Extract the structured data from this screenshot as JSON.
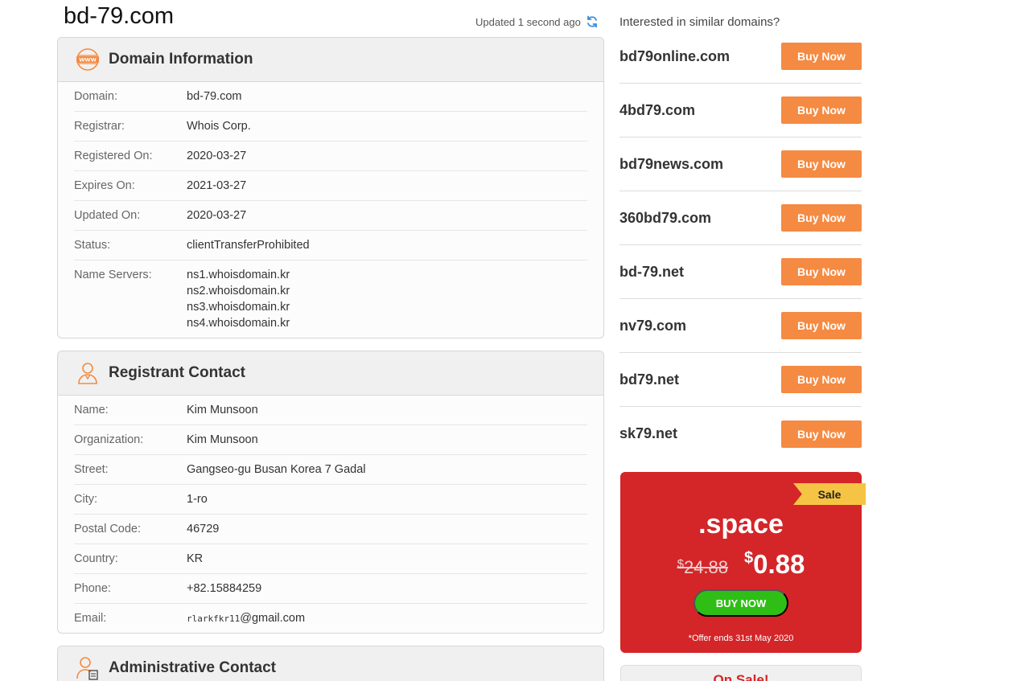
{
  "page": {
    "title": "bd-79.com",
    "updated": "Updated 1 second ago"
  },
  "colors": {
    "accent": "#f58a42",
    "promo_bg": "#d42528",
    "promo_btn": "#2fbe16",
    "ribbon": "#f6c444"
  },
  "domain_info": {
    "header": "Domain Information",
    "icon": "www-icon",
    "rows": [
      {
        "k": "Domain:",
        "v": "bd-79.com"
      },
      {
        "k": "Registrar:",
        "v": "Whois Corp."
      },
      {
        "k": "Registered On:",
        "v": "2020-03-27"
      },
      {
        "k": "Expires On:",
        "v": "2021-03-27"
      },
      {
        "k": "Updated On:",
        "v": "2020-03-27"
      },
      {
        "k": "Status:",
        "v": "clientTransferProhibited"
      }
    ],
    "ns_label": "Name Servers:",
    "ns": [
      "ns1.whoisdomain.kr",
      "ns2.whoisdomain.kr",
      "ns3.whoisdomain.kr",
      "ns4.whoisdomain.kr"
    ]
  },
  "registrant": {
    "header": "Registrant Contact",
    "icon": "person-icon",
    "rows": [
      {
        "k": "Name:",
        "v": "Kim Munsoon"
      },
      {
        "k": "Organization:",
        "v": "Kim Munsoon"
      },
      {
        "k": "Street:",
        "v": "Gangseo-gu Busan Korea 7 Gadal"
      },
      {
        "k": "City:",
        "v": "1-ro"
      },
      {
        "k": "Postal Code:",
        "v": "46729"
      },
      {
        "k": "Country:",
        "v": "KR"
      },
      {
        "k": "Phone:",
        "v": "+82.15884259"
      }
    ],
    "email_label": "Email:",
    "email_user": "rlarkfkr11",
    "email_domain": "@gmail.com"
  },
  "admin": {
    "header": "Administrative Contact",
    "icon": "admin-person-icon"
  },
  "sidebar": {
    "question": "Interested in similar domains?",
    "buy_label": "Buy Now",
    "domains": [
      "bd79online.com",
      "4bd79.com",
      "bd79news.com",
      "360bd79.com",
      "bd-79.net",
      "nv79.com",
      "bd79.net",
      "sk79.net"
    ]
  },
  "promo": {
    "ribbon": "Sale",
    "tld": ".space",
    "currency": "$",
    "old_price": "24.88",
    "new_price": "0.88",
    "button": "BUY NOW",
    "offer": "*Offer ends 31st May 2020"
  },
  "onsale": {
    "label": "On Sale!"
  }
}
